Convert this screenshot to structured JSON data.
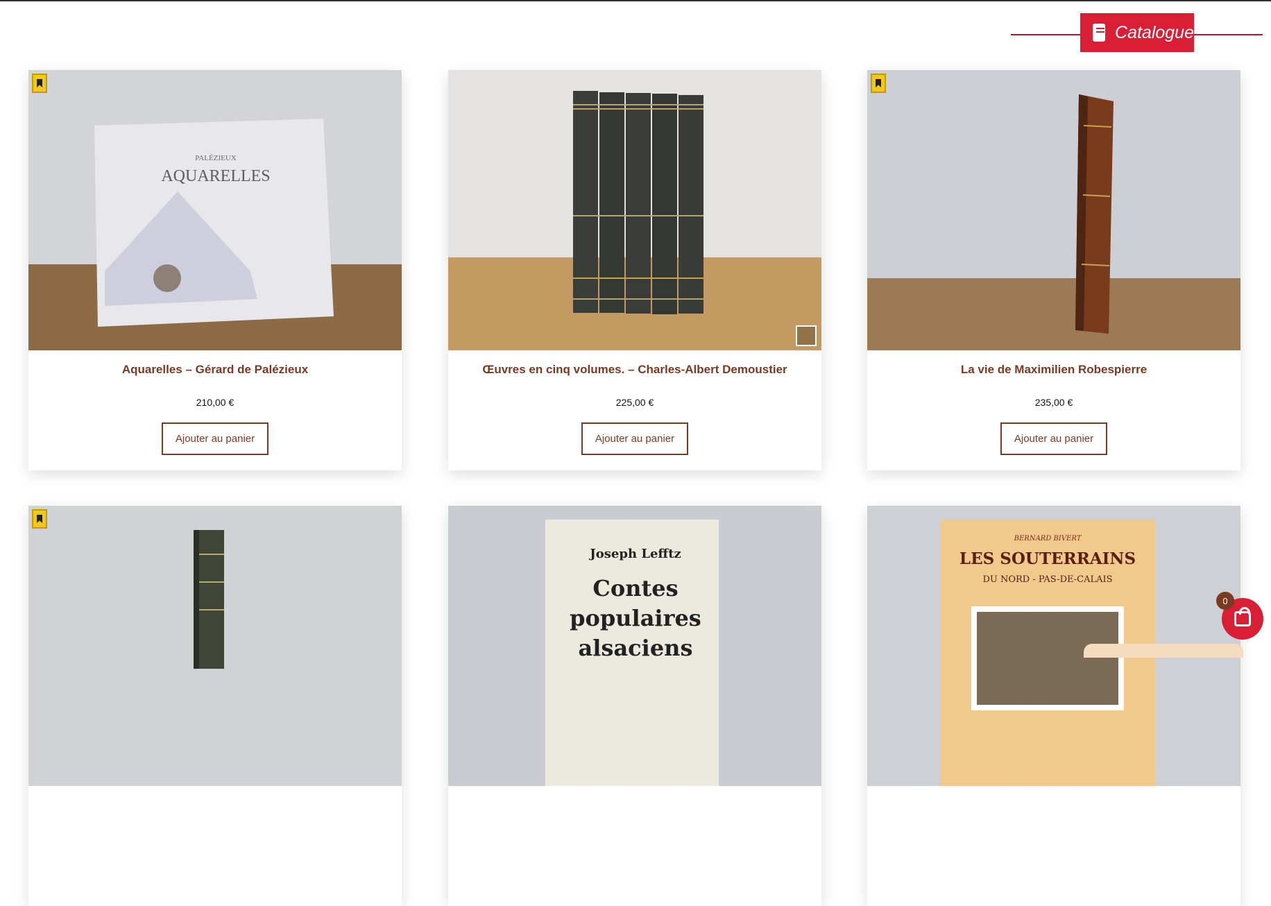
{
  "header": {
    "catalogue_label": "Catalogue"
  },
  "products": [
    {
      "title": "Aquarelles – Gérard de Palézieux",
      "price": "210,00 €",
      "button": "Ajouter au panier"
    },
    {
      "title": "Œuvres en cinq volumes. – Charles-Albert Demoustier",
      "price": "225,00 €",
      "button": "Ajouter au panier"
    },
    {
      "title": "La vie de Maximilien Robespierre",
      "price": "235,00 €",
      "button": "Ajouter au panier"
    }
  ],
  "covers": {
    "aquarelles_author": "PALÉZIEUX",
    "aquarelles_title": "AQUARELLES",
    "contes_author": "Joseph Lefftz",
    "contes_title_1": "Contes",
    "contes_title_2": "populaires",
    "contes_title_3": "alsaciens",
    "souterrains_author": "BERNARD BIVERT",
    "souterrains_title": "LES SOUTERRAINS",
    "souterrains_subtitle": "DU NORD - PAS-DE-CALAIS"
  },
  "cart": {
    "count": "0"
  },
  "colors": {
    "accent": "#d81f35",
    "brand_brown": "#7a3a22",
    "bookmark": "#f0c81e"
  },
  "icons": [
    "book-icon",
    "bookmark-icon",
    "cart-icon",
    "image-icon"
  ]
}
